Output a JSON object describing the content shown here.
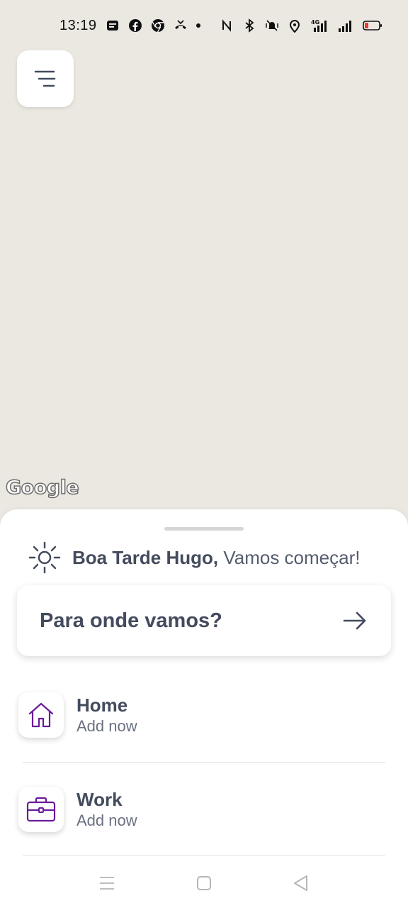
{
  "status_bar": {
    "time": "13:19",
    "left_icons": [
      "message-icon",
      "facebook-icon",
      "chrome-icon",
      "missed-call-icon"
    ],
    "right_icons": [
      "nfc-icon",
      "bluetooth-icon",
      "vibrate-icon",
      "location-icon",
      "4g-signal-icon",
      "signal-icon",
      "battery-low-icon"
    ],
    "battery_color": "#e53935"
  },
  "map": {
    "attribution": "Google",
    "background_color": "#ebe8e1"
  },
  "sheet": {
    "greeting_name": "Boa Tarde Hugo,",
    "greeting_text": "Vamos começar!",
    "greeting_icon": "sun-icon",
    "search_label": "Para onde vamos?",
    "search_icon": "arrow-right-icon",
    "places": [
      {
        "title": "Home",
        "subtitle": "Add now",
        "icon": "home-icon"
      },
      {
        "title": "Work",
        "subtitle": "Add now",
        "icon": "briefcase-icon"
      }
    ],
    "accent_color": "#6a1b9a"
  },
  "nav_bar": {
    "buttons": [
      "recents-icon",
      "home-nav-icon",
      "back-icon"
    ]
  }
}
